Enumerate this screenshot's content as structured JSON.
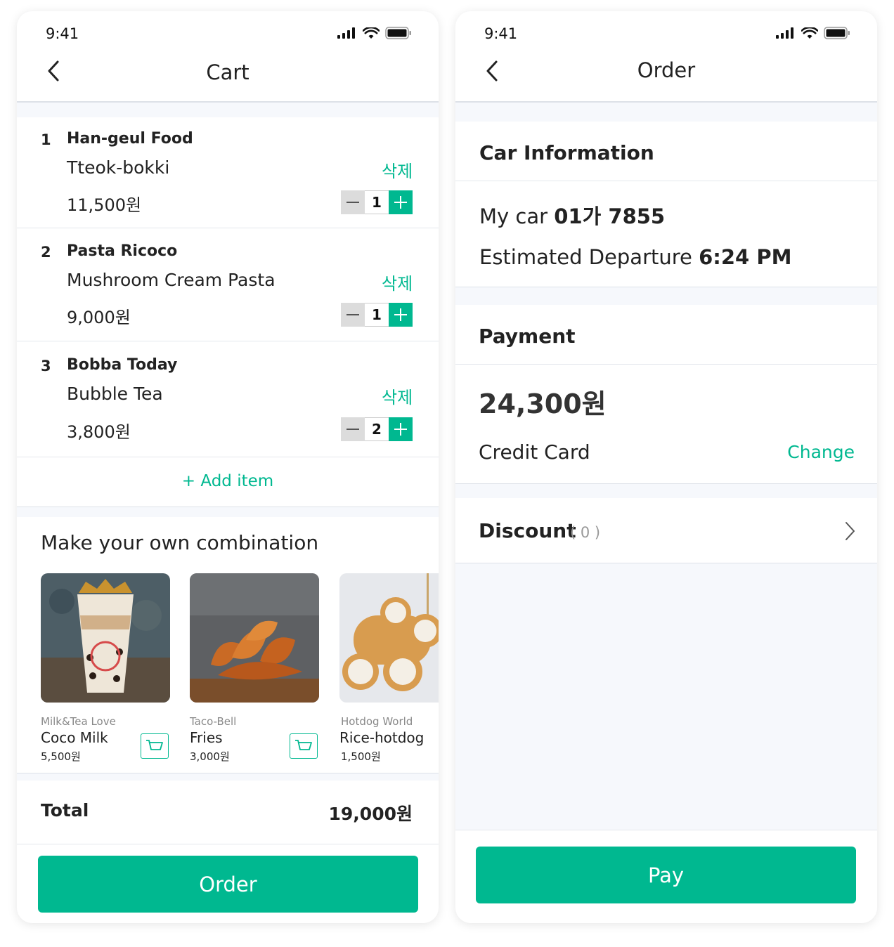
{
  "status": {
    "time": "9:41"
  },
  "cart": {
    "title": "Cart",
    "items": [
      {
        "index": "1",
        "shop": "Han-geul Food",
        "name": "Tteok-bokki",
        "price": "11,500원",
        "delete": "삭제",
        "qty": "1"
      },
      {
        "index": "2",
        "shop": "Pasta Ricoco",
        "name": "Mushroom Cream Pasta",
        "price": "9,000원",
        "delete": "삭제",
        "qty": "1"
      },
      {
        "index": "3",
        "shop": "Bobba Today",
        "name": "Bubble Tea",
        "price": "3,800원",
        "delete": "삭제",
        "qty": "2"
      }
    ],
    "add_item": "+ Add item",
    "combo_title": "Make your own combination",
    "combos": [
      {
        "shop": "Milk&Tea Love",
        "name": "Coco Milk",
        "price": "5,500원"
      },
      {
        "shop": "Taco-Bell",
        "name": "Fries",
        "price": "3,000원"
      },
      {
        "shop": "Hotdog World",
        "name": "Rice-hotdog",
        "price": "1,500원"
      }
    ],
    "total_label": "Total",
    "total_value": "19,000원",
    "order_button": "Order"
  },
  "order": {
    "title": "Order",
    "car_info_title": "Car Information",
    "my_car_label": "My car",
    "my_car_value": "01가 7855",
    "departure_label": "Estimated Departure",
    "departure_value": "6:24 PM",
    "payment_title": "Payment",
    "amount": "24,300원",
    "method": "Credit Card",
    "change": "Change",
    "discount_label": "Discount",
    "discount_count": "( 0 )",
    "pay_button": "Pay"
  },
  "colors": {
    "accent": "#00b890",
    "background": "#f6f8fc",
    "text": "#222222"
  },
  "icons": [
    "signal-icon",
    "wifi-icon",
    "battery-icon",
    "back-icon",
    "minus-icon",
    "plus-icon",
    "cart-icon",
    "chevron-right-icon"
  ]
}
